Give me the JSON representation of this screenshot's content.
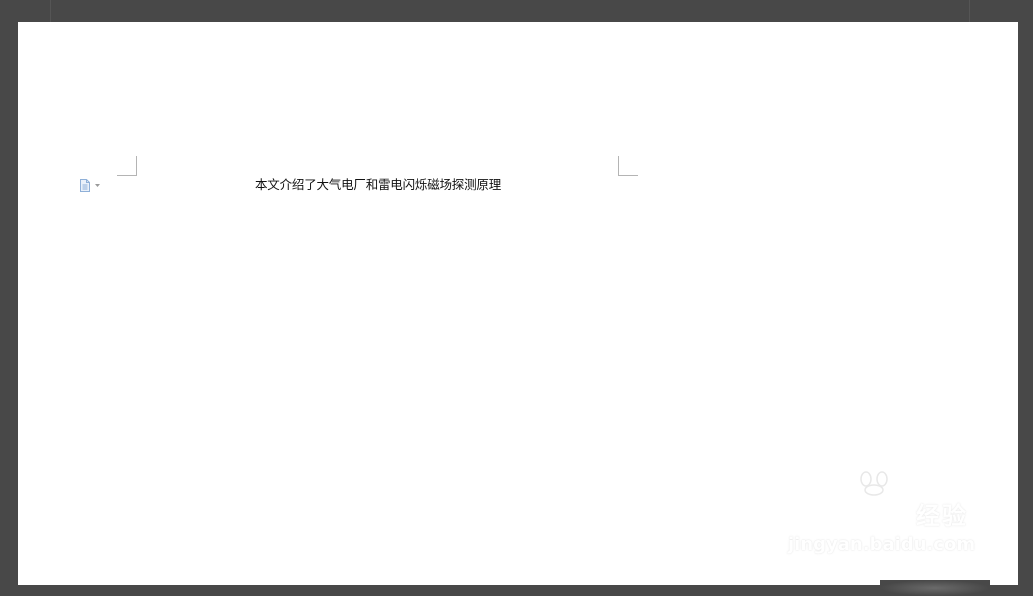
{
  "document": {
    "body_text": "本文介绍了大气电厂和雷电闪烁磁场探测原理"
  },
  "paste_options": {
    "icon": "document-icon",
    "dropdown_icon": "caret-down-icon"
  },
  "watermark": {
    "cn_text": "经验",
    "url_text": "jingyan.baidu.com"
  },
  "colors": {
    "workspace": "#484848",
    "page": "#ffffff",
    "corner_marks": "#b4b4b4",
    "text": "#111111",
    "icon": "#8fb0d8"
  }
}
